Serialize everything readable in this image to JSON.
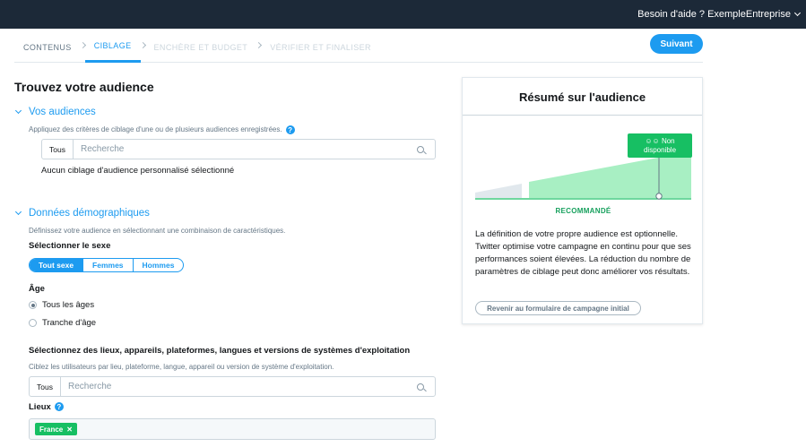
{
  "topbar": {
    "help": "Besoin d'aide ?",
    "account": "ExempleEntreprise"
  },
  "steps": [
    "CONTENUS",
    "CIBLAGE",
    "ENCHÈRE ET BUDGET",
    "VÉRIFIER ET FINALISER"
  ],
  "next_button": "Suivant",
  "page_title": "Trouvez votre audience",
  "audiences": {
    "heading": "Vos audiences",
    "description": "Appliquez des critères de ciblage d'une ou de plusieurs audiences enregistrées.",
    "scope": "Tous",
    "placeholder": "Recherche",
    "empty_text": "Aucun ciblage d'audience personnalisé sélectionné"
  },
  "demographics": {
    "heading": "Données démographiques",
    "description": "Définissez votre audience en sélectionnant une combinaison de caractéristiques.",
    "sex_label": "Sélectionner le sexe",
    "sex_options": [
      "Tout sexe",
      "Femmes",
      "Hommes"
    ],
    "age_label": "Âge",
    "age_options": [
      "Tous les âges",
      "Tranche d'âge"
    ]
  },
  "locations": {
    "heading": "Sélectionnez des lieux, appareils, plateformes, langues et versions de systèmes d'exploitation",
    "description": "Ciblez les utilisateurs par lieu, plateforme, langue, appareil ou version de système d'exploitation.",
    "scope": "Tous",
    "placeholder": "Recherche",
    "lieux_label": "Lieux",
    "chip": "France"
  },
  "summary": {
    "title": "Résumé sur l'audience",
    "tag_line1": "Non",
    "tag_line2": "disponible",
    "recommended": "RECOMMANDÉ",
    "text": "La définition de votre propre audience est optionnelle. Twitter optimise votre campagne en continu pour que ses performances soient élevées. La réduction du nombre de paramètres de ciblage peut donc améliorer vos résultats.",
    "back_button": "Revenir au formulaire de campagne initial"
  },
  "colors": {
    "accent": "#1d9bf0",
    "green": "#17bf63",
    "topbar": "#1c2938"
  },
  "icons": [
    "chevron-down-icon",
    "chevron-right-icon",
    "help-icon",
    "search-icon",
    "people-icon",
    "close-icon"
  ]
}
